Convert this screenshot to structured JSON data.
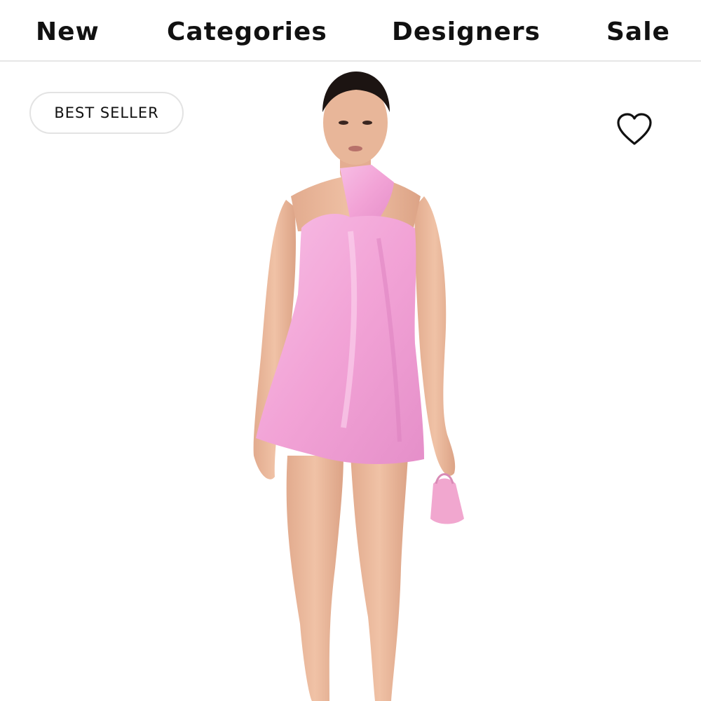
{
  "nav": {
    "items": [
      {
        "label": "New"
      },
      {
        "label": "Categories"
      },
      {
        "label": "Designers"
      },
      {
        "label": "Sale"
      }
    ]
  },
  "product": {
    "badge": "BEST SELLER",
    "wishlist_icon": "heart-outline-icon",
    "dress_color": "#f2a6d8",
    "skin_color": "#e9b79a",
    "hair_color": "#1c1412"
  }
}
